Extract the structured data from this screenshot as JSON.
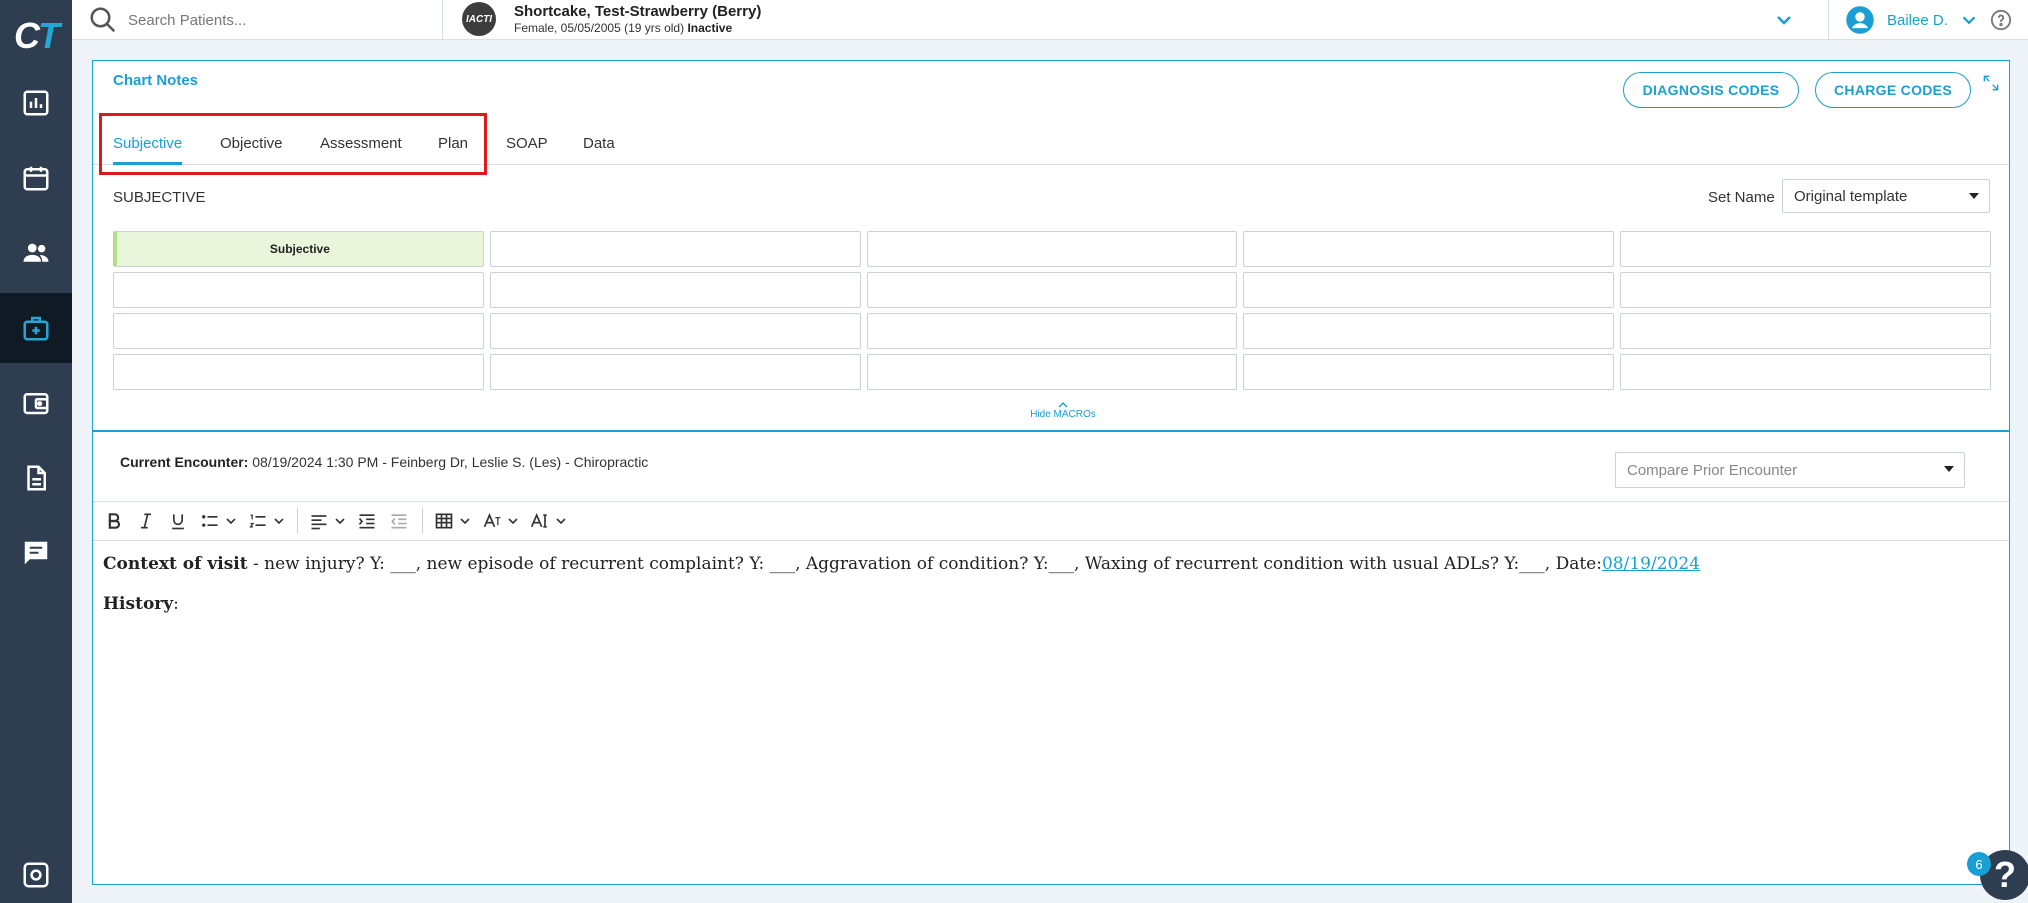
{
  "app": {
    "logo_c": "C",
    "logo_t": "T"
  },
  "nav": {
    "items": [
      {
        "name": "dashboard-icon"
      },
      {
        "name": "calendar-icon"
      },
      {
        "name": "patients-icon"
      },
      {
        "name": "medical-kit-icon",
        "active": true
      },
      {
        "name": "wallet-icon"
      },
      {
        "name": "document-icon"
      },
      {
        "name": "chat-icon"
      },
      {
        "name": "settings-icon"
      }
    ]
  },
  "search": {
    "placeholder": "Search Patients..."
  },
  "patient": {
    "avatar_text": "IACTI",
    "name": "Shortcake, Test-Strawberry (Berry)",
    "details": "Female, 05/05/2005 (19 yrs old)",
    "status": "Inactive"
  },
  "user": {
    "name": "Bailee D."
  },
  "chart": {
    "title": "Chart Notes",
    "diagnosis_button": "DIAGNOSIS CODES",
    "charge_button": "CHARGE CODES",
    "tabs": [
      "Subjective",
      "Objective",
      "Assessment",
      "Plan",
      "SOAP",
      "Data"
    ],
    "active_tab": "Subjective",
    "section_label": "SUBJECTIVE",
    "set_name_label": "Set Name",
    "set_name_value": "Original template",
    "macros": [
      "Subjective"
    ],
    "hide_macros_label": "Hide MACROs"
  },
  "encounter": {
    "label": "Current Encounter:",
    "value": "08/19/2024 1:30 PM - Feinberg Dr, Leslie S. (Les) - Chiropractic",
    "compare_placeholder": "Compare Prior Encounter"
  },
  "editor": {
    "line1_bold": "Context of visit",
    "line1_text": " - new injury? Y: ___, new episode of recurrent complaint? Y: ___, Aggravation of condition? Y:___, Waxing of recurrent condition with usual ADLs? Y:___, Date:",
    "line1_link": "08/19/2024",
    "line2_bold": "History",
    "line2_text": ":"
  },
  "help": {
    "badge": "6",
    "label": "?"
  },
  "colors": {
    "accent": "#1a9fd4",
    "nav_bg": "#2e3d4f",
    "highlight": "#e0191d",
    "macro_fill": "#eaf6dc"
  }
}
